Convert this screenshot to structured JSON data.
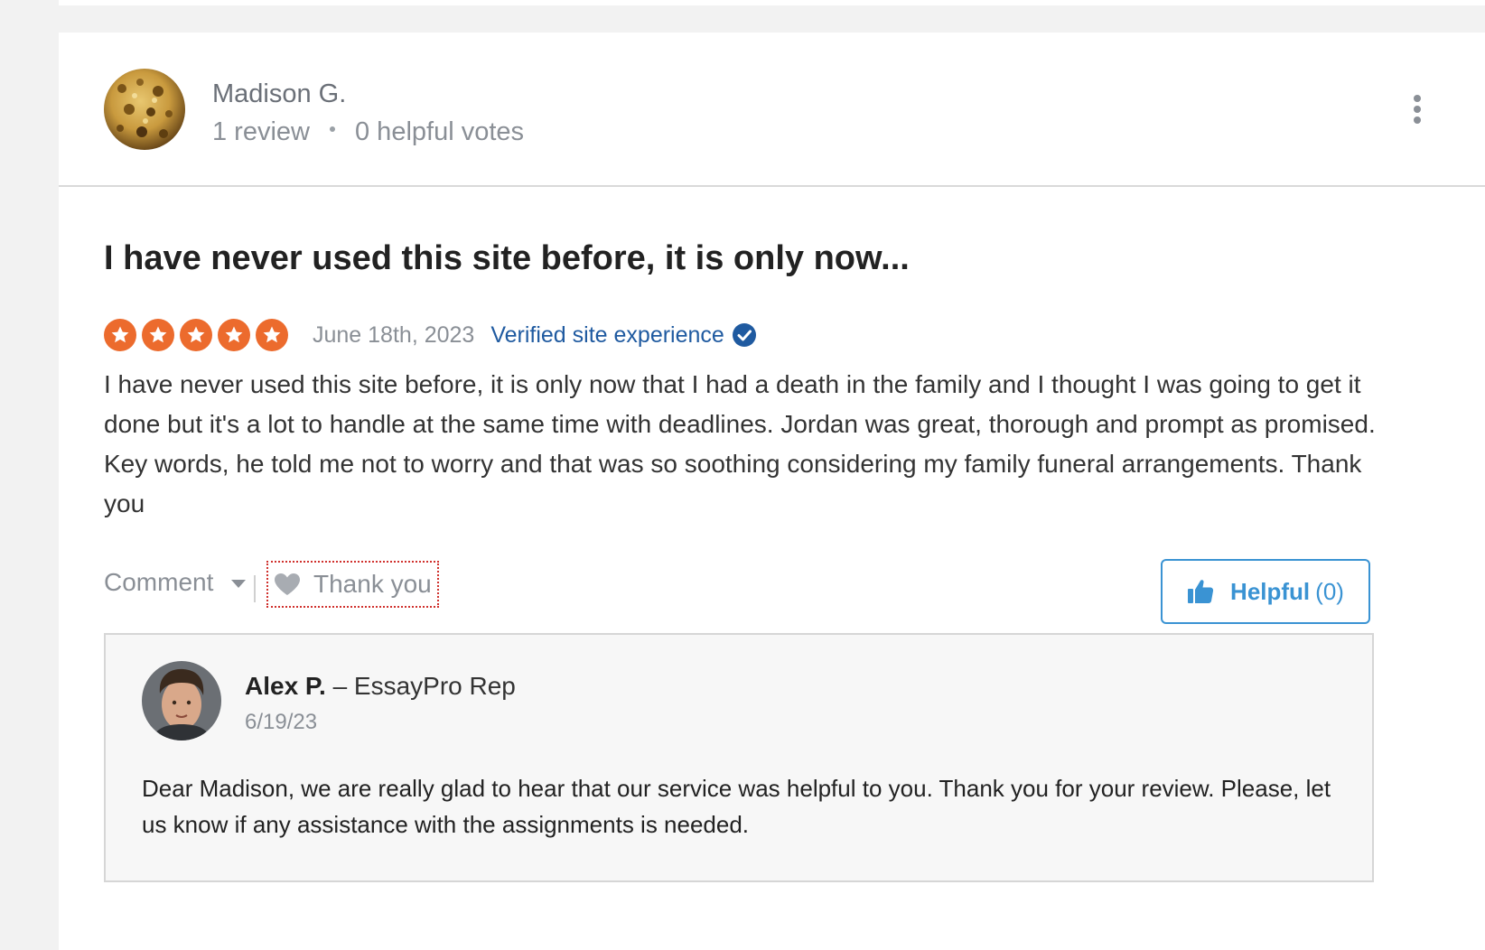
{
  "review": {
    "reviewer": {
      "name": "Madison G.",
      "reviews": "1 review",
      "helpful_votes": "0 helpful votes"
    },
    "title": "I have never used this site before, it is only now...",
    "rating": 5,
    "rating_max": 5,
    "date": "June 18th, 2023",
    "verified_label": "Verified site experience",
    "body": "I have never used this site before, it is only now that I had a death in the family and I thought I was going to get it done but it's a lot to handle at the same time with deadlines. Jordan was great, thorough and prompt as promised. Key words, he told me not to worry and that was so soothing considering my family funeral arrangements. Thank you"
  },
  "actions": {
    "comment_label": "Comment",
    "thanks_label": "Thank you",
    "helpful_label": "Helpful",
    "helpful_count": "(0)"
  },
  "reply": {
    "name": "Alex P.",
    "role": "– EssayPro Rep",
    "date": "6/19/23",
    "body": "Dear Madison, we are really glad to hear that our service was helpful to you. Thank you for your review. Please, let us know if any assistance with the assignments is needed."
  },
  "icons": {
    "star": "star-icon",
    "verified": "check-circle-icon",
    "more": "more-vertical-icon",
    "heart": "heart-icon",
    "thumb": "thumbs-up-icon",
    "caret": "caret-down-icon"
  },
  "colors": {
    "star": "#ec6b2d",
    "verified": "#1f5aa0",
    "helpful": "#3a93d3",
    "focus_outline": "#d0312d"
  }
}
